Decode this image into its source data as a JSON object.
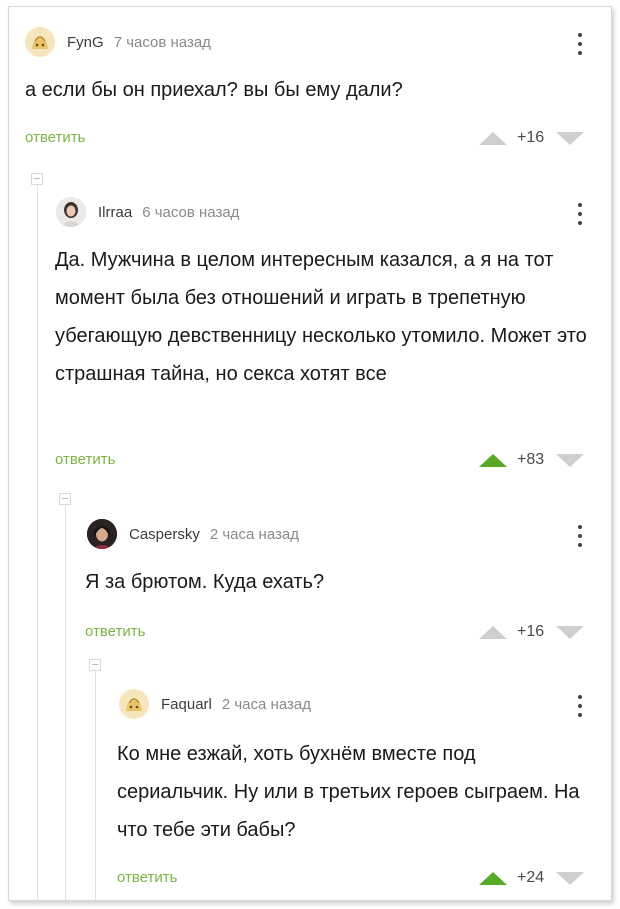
{
  "comments": [
    {
      "username": "FynG",
      "time": "7 часов назад",
      "text": "а если бы он приехал? вы бы ему дали?",
      "reply": "ответить",
      "score": "+16",
      "voted": false
    },
    {
      "username": "Ilrraa",
      "time": "6 часов назад",
      "text": "Да. Мужчина в целом интересным казался, а я на тот момент была без отношений и играть в трепетную убегающую девственницу несколько утомило. Может это страшная тайна, но секса хотят все",
      "reply": "ответить",
      "score": "+83",
      "voted": true
    },
    {
      "username": "Caspersky",
      "time": "2 часа назад",
      "text": "Я за брютом. Куда ехать?",
      "reply": "ответить",
      "score": "+16",
      "voted": false
    },
    {
      "username": "Faquarl",
      "time": "2 часа назад",
      "text": "Ко мне езжай, хоть бухнём вместе под сериальчик. Ну или в третьих героев сыграем. На что тебе эти бабы?",
      "reply": "ответить",
      "score": "+24",
      "voted": true
    }
  ],
  "colors": {
    "reply_link": "#7ab545",
    "upvote_active": "#5aaa2a",
    "vote_inactive": "#cfcfcf"
  },
  "icons": [
    "default-avatar-icon",
    "user-photo-avatar",
    "more-vertical-icon",
    "collapse-thread-icon",
    "upvote-icon",
    "downvote-icon"
  ]
}
